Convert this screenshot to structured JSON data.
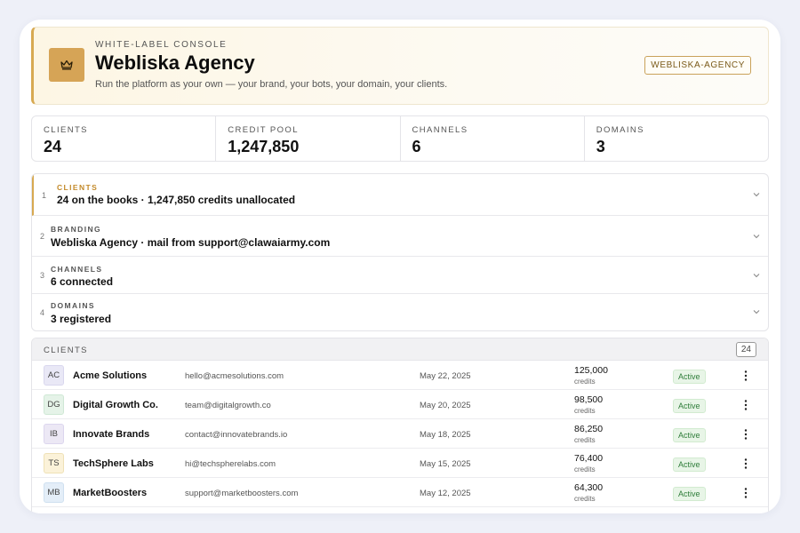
{
  "header": {
    "eyebrow": "WHITE-LABEL CONSOLE",
    "title": "Webliska Agency",
    "subtitle": "Run the platform as your own — your brand, your bots, your domain, your clients.",
    "tag": "WEBLISKA-AGENCY",
    "logo_icon": "crown-icon",
    "accent_color": "#d6a456"
  },
  "stats": [
    {
      "label": "CLIENTS",
      "value": "24"
    },
    {
      "label": "CREDIT POOL",
      "value": "1,247,850"
    },
    {
      "label": "CHANNELS",
      "value": "6"
    },
    {
      "label": "DOMAINS",
      "value": "3"
    }
  ],
  "sections": [
    {
      "num": "1",
      "label": "CLIENTS",
      "text": "24 on the books · 1,247,850 credits unallocated"
    },
    {
      "num": "2",
      "label": "BRANDING",
      "text": "Webliska Agency · mail from support@clawaiarmy.com"
    },
    {
      "num": "3",
      "label": "CHANNELS",
      "text": "6 connected"
    },
    {
      "num": "4",
      "label": "DOMAINS",
      "text": "3 registered"
    }
  ],
  "clients_table": {
    "label": "CLIENTS",
    "count": "24",
    "credits_unit": "credits",
    "rows": [
      {
        "initials": "AC",
        "name": "Acme Solutions",
        "email": "hello@acmesolutions.com",
        "date": "May 22, 2025",
        "credits": "125,000",
        "status": "Active",
        "avatar_bg": "#e9e8f6",
        "avatar_border": "#d9d7ee"
      },
      {
        "initials": "DG",
        "name": "Digital Growth Co.",
        "email": "team@digitalgrowth.co",
        "date": "May 20, 2025",
        "credits": "98,500",
        "status": "Active",
        "avatar_bg": "#e5f3e8",
        "avatar_border": "#cfe8d5"
      },
      {
        "initials": "IB",
        "name": "Innovate Brands",
        "email": "contact@innovatebrands.io",
        "date": "May 18, 2025",
        "credits": "86,250",
        "status": "Active",
        "avatar_bg": "#ece8f5",
        "avatar_border": "#dcd6ee"
      },
      {
        "initials": "TS",
        "name": "TechSphere Labs",
        "email": "hi@techspherelabs.com",
        "date": "May 15, 2025",
        "credits": "76,400",
        "status": "Active",
        "avatar_bg": "#fbf2d9",
        "avatar_border": "#efe1b6"
      },
      {
        "initials": "MB",
        "name": "MarketBoosters",
        "email": "support@marketboosters.com",
        "date": "May 12, 2025",
        "credits": "64,300",
        "status": "Active",
        "avatar_bg": "#e4eef8",
        "avatar_border": "#cfe0f0"
      }
    ]
  }
}
